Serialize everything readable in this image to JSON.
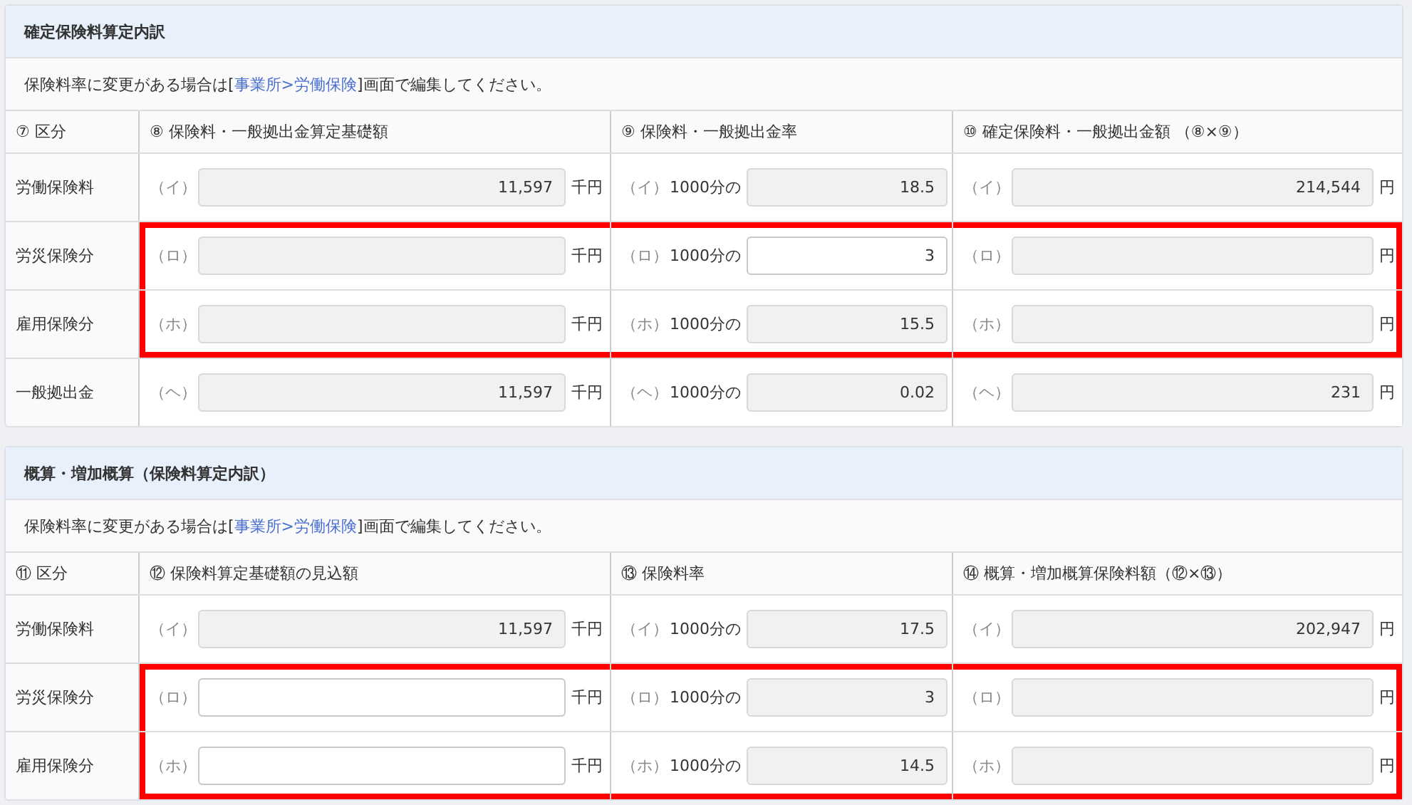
{
  "sections": [
    {
      "title": "確定保険料算定内訳",
      "note": {
        "before": "保険料率に変更がある場合は[",
        "link": "事業所>労働保険",
        "after": "]画面で編集してください。"
      },
      "columns": [
        "⑦ 区分",
        "⑧ 保険料・一般拠出金算定基礎額",
        "⑨ 保険料・一般拠出金率",
        "⑩ 確定保険料・一般拠出金額 （⑧×⑨）"
      ],
      "rows": [
        {
          "highlighted": false,
          "cells": [
            {
              "kind": "label",
              "text": "労働保険料"
            },
            {
              "kind": "base",
              "mark": "（イ）",
              "value": "11,597",
              "unit": "千円",
              "disabled": true
            },
            {
              "kind": "rate",
              "mark": "（イ）",
              "prefix": "1000分の",
              "value": "18.5",
              "disabled": true
            },
            {
              "kind": "amount",
              "mark": "（イ）",
              "value": "214,544",
              "unit": "円",
              "disabled": true
            }
          ]
        },
        {
          "highlighted": true,
          "cells": [
            {
              "kind": "label",
              "text": "労災保険分"
            },
            {
              "kind": "base",
              "mark": "（ロ）",
              "unit": "千円",
              "disabled": true
            },
            {
              "kind": "rate",
              "mark": "（ロ）",
              "prefix": "1000分の",
              "value": "3",
              "disabled": false
            },
            {
              "kind": "amount",
              "mark": "（ロ）",
              "unit": "円",
              "disabled": true
            }
          ]
        },
        {
          "highlighted": true,
          "cells": [
            {
              "kind": "label",
              "text": "雇用保険分"
            },
            {
              "kind": "base",
              "mark": "（ホ）",
              "unit": "千円",
              "disabled": true
            },
            {
              "kind": "rate",
              "mark": "（ホ）",
              "prefix": "1000分の",
              "value": "15.5",
              "disabled": true
            },
            {
              "kind": "amount",
              "mark": "（ホ）",
              "unit": "円",
              "disabled": true
            }
          ]
        },
        {
          "highlighted": false,
          "cells": [
            {
              "kind": "label",
              "text": "一般拠出金"
            },
            {
              "kind": "base",
              "mark": "（ヘ）",
              "value": "11,597",
              "unit": "千円",
              "disabled": true
            },
            {
              "kind": "rate",
              "mark": "（ヘ）",
              "prefix": "1000分の",
              "value": "0.02",
              "disabled": true
            },
            {
              "kind": "amount",
              "mark": "（ヘ）",
              "value": "231",
              "unit": "円",
              "disabled": true
            }
          ]
        }
      ]
    },
    {
      "title": "概算・増加概算（保険料算定内訳）",
      "note": {
        "before": "保険料率に変更がある場合は[",
        "link": "事業所>労働保険",
        "after": "]画面で編集してください。"
      },
      "columns": [
        "⑪ 区分",
        "⑫ 保険料算定基礎額の見込額",
        "⑬ 保険料率",
        "⑭ 概算・増加概算保険料額（⑫×⑬）"
      ],
      "rows": [
        {
          "highlighted": false,
          "cells": [
            {
              "kind": "label",
              "text": "労働保険料"
            },
            {
              "kind": "base",
              "mark": "（イ）",
              "value": "11,597",
              "unit": "千円",
              "disabled": true
            },
            {
              "kind": "rate",
              "mark": "（イ）",
              "prefix": "1000分の",
              "value": "17.5",
              "disabled": true
            },
            {
              "kind": "amount",
              "mark": "（イ）",
              "value": "202,947",
              "unit": "円",
              "disabled": true
            }
          ]
        },
        {
          "highlighted": true,
          "cells": [
            {
              "kind": "label",
              "text": "労災保険分"
            },
            {
              "kind": "base",
              "mark": "（ロ）",
              "unit": "千円",
              "disabled": false
            },
            {
              "kind": "rate",
              "mark": "（ロ）",
              "prefix": "1000分の",
              "value": "3",
              "disabled": true
            },
            {
              "kind": "amount",
              "mark": "（ロ）",
              "unit": "円",
              "disabled": true
            }
          ]
        },
        {
          "highlighted": true,
          "cells": [
            {
              "kind": "label",
              "text": "雇用保険分"
            },
            {
              "kind": "base",
              "mark": "（ホ）",
              "unit": "千円",
              "disabled": false
            },
            {
              "kind": "rate",
              "mark": "（ホ）",
              "prefix": "1000分の",
              "value": "14.5",
              "disabled": true
            },
            {
              "kind": "amount",
              "mark": "（ホ）",
              "unit": "円",
              "disabled": true
            }
          ]
        }
      ]
    }
  ]
}
